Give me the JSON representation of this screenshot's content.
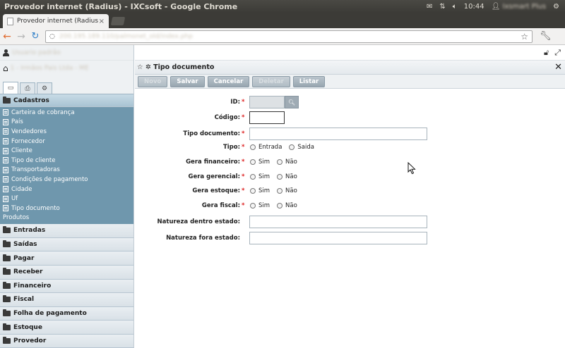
{
  "os": {
    "window_title": "Provedor internet (Radius) - IXCsoft - Google Chrome",
    "time": "10:44",
    "user": "Ixsmart Plus"
  },
  "browser": {
    "tab_title": "Provedor internet (Radius",
    "tab_close": "×",
    "url": "200.195.189.110/palmonet_old/index.php"
  },
  "side": {
    "user_name": "Usuario padrão",
    "company": "1 - Irmãos Pais Ltda - ME",
    "tabs": [
      {
        "name": "window-icon",
        "glyph": "▭"
      },
      {
        "name": "print-icon",
        "glyph": "⎙"
      },
      {
        "name": "gear-icon",
        "glyph": "⚙"
      }
    ],
    "open_section": "Cadastros",
    "cadastros_items": [
      "Carteira de cobrança",
      "País",
      "Vendedores",
      "Fornecedor",
      "Cliente",
      "Tipo de cliente",
      "Transportadoras",
      "Condições de pagamento",
      "Cidade",
      "Uf",
      "Tipo documento",
      "Produtos"
    ],
    "sections": [
      "Entradas",
      "Saídas",
      "Pagar",
      "Receber",
      "Financeiro",
      "Fiscal",
      "Folha de pagamento",
      "Estoque",
      "Provedor"
    ]
  },
  "form": {
    "title": "Tipo documento",
    "buttons": {
      "novo": "Novo",
      "salvar": "Salvar",
      "cancelar": "Cancelar",
      "deletar": "Deletar",
      "listar": "Listar"
    },
    "labels": {
      "id": "ID:",
      "codigo": "Código:",
      "tipo_documento": "Tipo documento:",
      "tipo": "Tipo:",
      "gera_financeiro": "Gera financeiro:",
      "gera_gerencial": "Gera gerencial:",
      "gera_estoque": "Gera estoque:",
      "gera_fiscal": "Gera fiscal:",
      "natureza_dentro": "Natureza dentro estado:",
      "natureza_fora": "Natureza fora estado:"
    },
    "required_mark": "*",
    "options": {
      "entrada": "Entrada",
      "saida": "Saida",
      "sim": "Sim",
      "nao": "Não"
    },
    "values": {
      "id": "",
      "codigo": "",
      "tipo_documento": "",
      "natureza_dentro": "",
      "natureza_fora": ""
    }
  },
  "colors": {
    "menu_accent": "#6f97ad",
    "required": "#dd2222",
    "button": "#a8b4bc"
  }
}
